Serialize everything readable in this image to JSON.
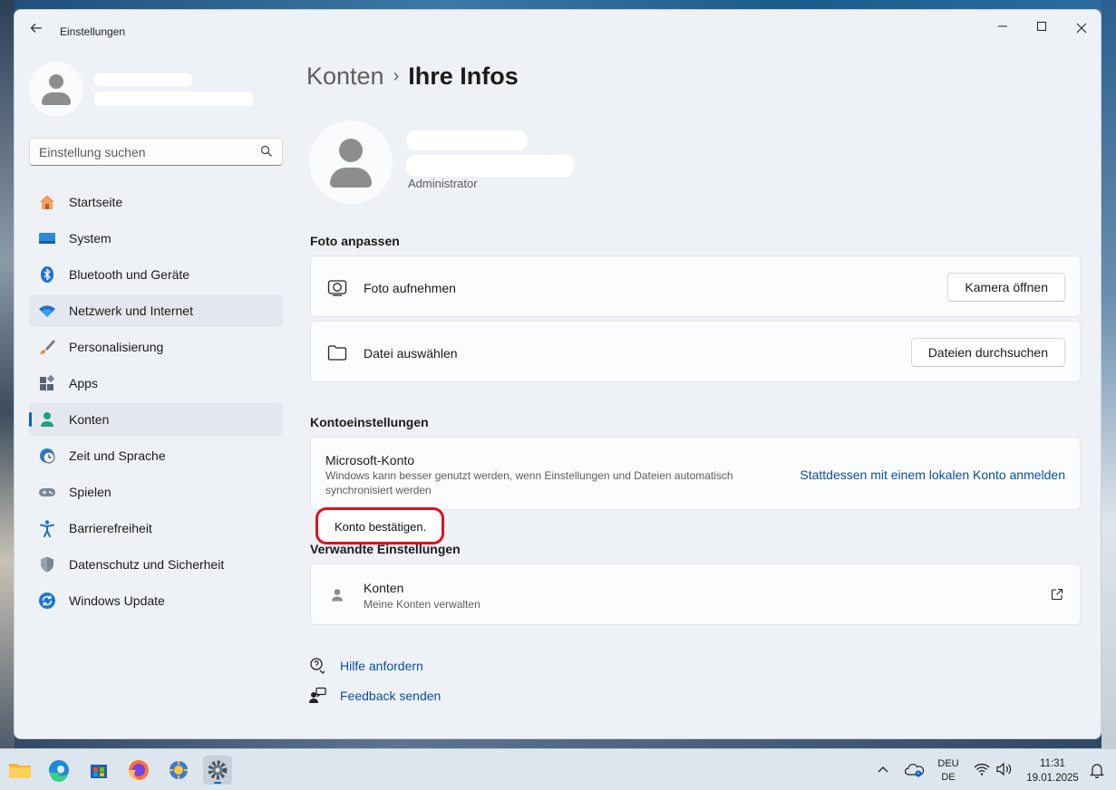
{
  "window": {
    "title": "Einstellungen",
    "back_icon": "back-arrow-icon",
    "minimize_icon": "minimize-icon",
    "maximize_icon": "maximize-icon",
    "close_icon": "close-icon"
  },
  "search": {
    "placeholder": "Einstellung suchen"
  },
  "sidebar": {
    "items": [
      {
        "label": "Startseite",
        "icon": "home-icon"
      },
      {
        "label": "System",
        "icon": "system-display-icon"
      },
      {
        "label": "Bluetooth und Geräte",
        "icon": "bluetooth-icon"
      },
      {
        "label": "Netzwerk und Internet",
        "icon": "wifi-icon"
      },
      {
        "label": "Personalisierung",
        "icon": "brush-icon"
      },
      {
        "label": "Apps",
        "icon": "apps-icon"
      },
      {
        "label": "Konten",
        "icon": "account-icon"
      },
      {
        "label": "Zeit und Sprache",
        "icon": "clock-globe-icon"
      },
      {
        "label": "Spielen",
        "icon": "gamepad-icon"
      },
      {
        "label": "Barrierefreiheit",
        "icon": "accessibility-icon"
      },
      {
        "label": "Datenschutz und Sicherheit",
        "icon": "shield-icon"
      },
      {
        "label": "Windows Update",
        "icon": "update-icon"
      }
    ],
    "active_index": 6
  },
  "main": {
    "breadcrumb": {
      "parent": "Konten",
      "current": "Ihre Infos"
    },
    "user": {
      "role": "Administrator"
    },
    "photo_section": {
      "title": "Foto anpassen",
      "take_photo": {
        "label": "Foto aufnehmen",
        "button": "Kamera öffnen",
        "icon": "camera-icon"
      },
      "choose_file": {
        "label": "Datei auswählen",
        "button": "Dateien durchsuchen",
        "icon": "folder-icon"
      }
    },
    "account_section": {
      "title": "Kontoeinstellungen",
      "microsoft_account": {
        "label": "Microsoft-Konto",
        "description_line1": "Windows kann besser genutzt werden, wenn Einstellungen und Dateien automatisch",
        "description_line2": "synchronisiert werden",
        "link": "Stattdessen mit einem lokalen Konto anmelden"
      },
      "highlight_text": "Konto bestätigen."
    },
    "related_section": {
      "title": "Verwandte Einstellungen",
      "accounts": {
        "label": "Konten",
        "sub": "Meine Konten verwalten",
        "icon": "person-icon",
        "link_icon": "open-external-icon"
      }
    },
    "help_links": [
      {
        "label": "Hilfe anfordern",
        "icon": "help-chat-icon"
      },
      {
        "label": "Feedback senden",
        "icon": "feedback-icon"
      }
    ]
  },
  "taskbar": {
    "apps": [
      "file-explorer-icon",
      "edge-icon",
      "store-icon",
      "firefox-icon",
      "sun-app-icon",
      "settings-gear-icon"
    ],
    "language_line1": "DEU",
    "language_line2": "DE",
    "time": "11:31",
    "date": "19.01.2025"
  }
}
